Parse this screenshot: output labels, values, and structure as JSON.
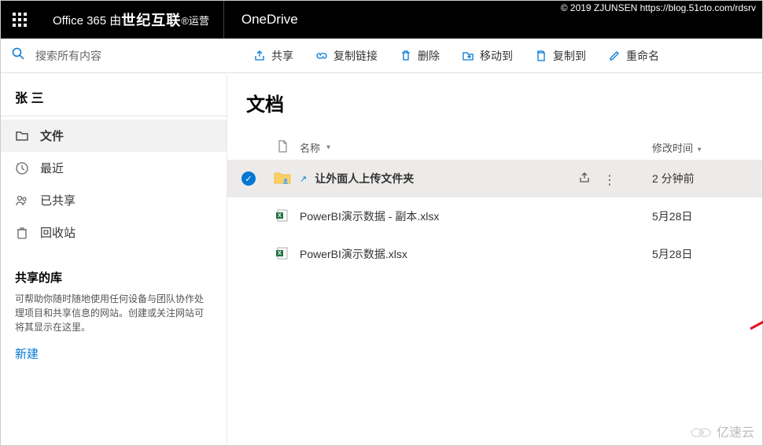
{
  "watermark_top": "© 2019 ZJUNSEN https://blog.51cto.com/rdsrv",
  "watermark_bottom": "亿速云",
  "topbar": {
    "brand_prefix": "Office 365 由",
    "brand_strong": "世纪互联",
    "brand_suffix": "®运营",
    "app": "OneDrive"
  },
  "search": {
    "placeholder": "搜索所有内容"
  },
  "commands": {
    "share": "共享",
    "copylink": "复制链接",
    "delete": "删除",
    "moveto": "移动到",
    "copyto": "复制到",
    "rename": "重命名"
  },
  "sidebar": {
    "user": "张 三",
    "items": [
      {
        "label": "文件",
        "icon": "folder"
      },
      {
        "label": "最近",
        "icon": "clock"
      },
      {
        "label": "已共享",
        "icon": "people"
      },
      {
        "label": "回收站",
        "icon": "recycle"
      }
    ],
    "lib_header": "共享的库",
    "lib_desc": "可帮助你随时随地使用任何设备与团队协作处理项目和共享信息的网站。创建或关注网站可将其显示在这里。",
    "new_btn": "新建"
  },
  "main": {
    "title": "文档",
    "columns": {
      "name": "名称",
      "modified": "修改时间"
    },
    "tooltip": "共享",
    "rows": [
      {
        "name": "让外面人上传文件夹",
        "modified": "2 分钟前",
        "type": "folder-shared",
        "selected": true
      },
      {
        "name": "PowerBI演示数据 - 副本.xlsx",
        "modified": "5月28日",
        "type": "xlsx",
        "selected": false
      },
      {
        "name": "PowerBI演示数据.xlsx",
        "modified": "5月28日",
        "type": "xlsx",
        "selected": false
      }
    ]
  }
}
